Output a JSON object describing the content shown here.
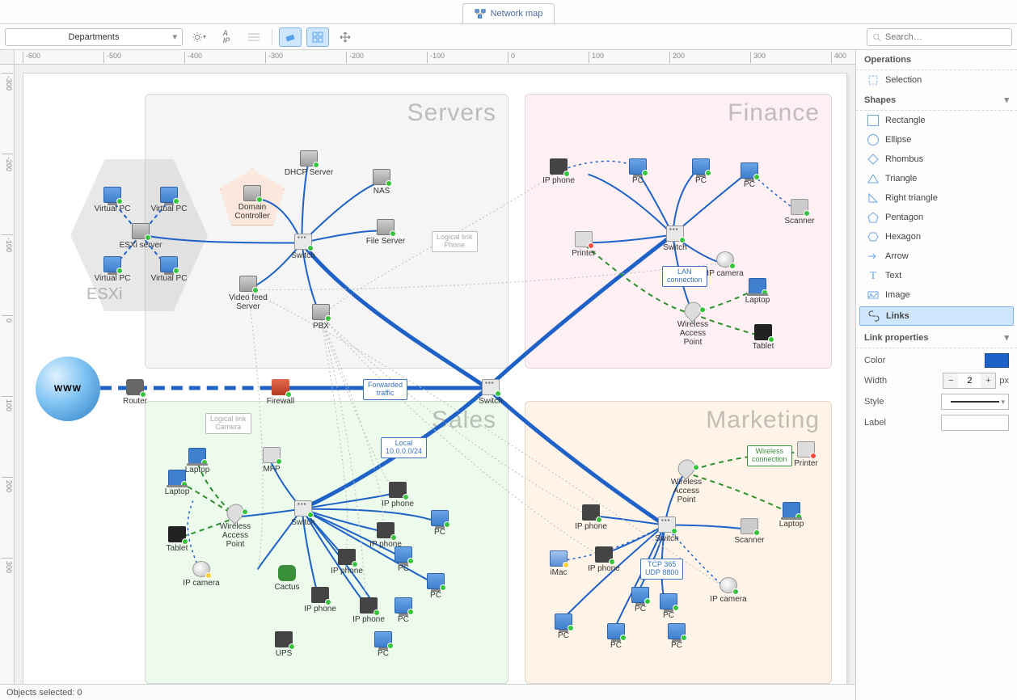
{
  "tab": {
    "title": "Network map"
  },
  "toolbar": {
    "select_value": "Departments"
  },
  "search": {
    "placeholder": "Search…"
  },
  "status": {
    "text": "Objects selected: 0"
  },
  "globe": {
    "label": "WWW"
  },
  "hex": {
    "label": "ESXi"
  },
  "groups": {
    "servers": "Servers",
    "finance": "Finance",
    "sales": "Sales",
    "marketing": "Marketing"
  },
  "link_labels": {
    "forwarded": "Forwarded\ntraffic",
    "local": "Local\n10.0.0.0/24",
    "lan": "LAN\nconnection",
    "tcp": "TCP 365\nUDP 8800",
    "wireless": "Wireless\nconnection",
    "logical_phone": "Logical link\nPhone",
    "logical_camera": "Logical link\nCamera"
  },
  "nodes": {
    "virtual_pc": "Virtual PC",
    "esxi_server": "ESXi server",
    "domain_controller": "Domain\nController",
    "dhcp": "DHCP Server",
    "nas": "NAS",
    "file_server": "File Server",
    "switch": "Switch",
    "video_feed": "Video feed\nServer",
    "pbx": "PBX",
    "router": "Router",
    "firewall": "Firewall",
    "ip_phone": "IP phone",
    "pc": "PC",
    "scanner": "Scanner",
    "printer": "Printer",
    "ip_camera": "IP camera",
    "laptop": "Laptop",
    "wap": "Wireless Access\nPoint",
    "tablet": "Tablet",
    "mfp": "MFP",
    "ups": "UPS",
    "cactus": "Cactus",
    "imac": "iMac"
  },
  "ruler_h": [
    "-600",
    "-500",
    "-400",
    "-300",
    "-200",
    "-100",
    "0",
    "100",
    "200",
    "300",
    "400"
  ],
  "ruler_v": [
    "-300",
    "-200",
    "-100",
    "0",
    "100",
    "200",
    "300"
  ],
  "sidebar": {
    "operations": "Operations",
    "selection": "Selection",
    "shapes": "Shapes",
    "rectangle": "Rectangle",
    "ellipse": "Ellipse",
    "rhombus": "Rhombus",
    "triangle": "Triangle",
    "right_triangle": "Right triangle",
    "pentagon": "Pentagon",
    "hexagon": "Hexagon",
    "arrow": "Arrow",
    "text": "Text",
    "image": "Image",
    "links": "Links",
    "link_props": "Link properties",
    "color": "Color",
    "width": "Width",
    "width_val": "2",
    "width_unit": "px",
    "style": "Style",
    "label": "Label"
  }
}
